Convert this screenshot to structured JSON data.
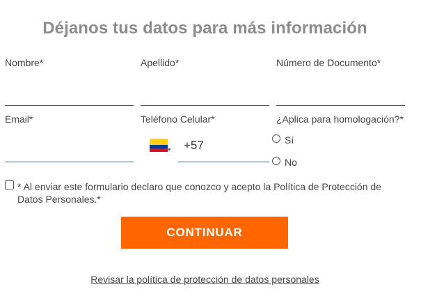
{
  "form": {
    "title": "Déjanos tus datos para más información",
    "fields": {
      "nombre": {
        "label": "Nombre*",
        "value": ""
      },
      "apellido": {
        "label": "Apellido*",
        "value": ""
      },
      "documento": {
        "label": "Número de Documento*",
        "value": ""
      },
      "email": {
        "label": "Email*",
        "value": ""
      },
      "telefono": {
        "label": "Teléfono Celular*",
        "value": "",
        "country_code": "+57",
        "flag_icon": "colombia-flag-icon"
      },
      "homologacion": {
        "label": "¿Aplica para homologación?*",
        "options": [
          "Sí",
          "No"
        ],
        "selected": null
      }
    },
    "consent_text": "* Al enviar este formulario declaro que conozco y acepto la Política de Protección de Datos Personales.*",
    "consent_checked": false,
    "submit_label": "CONTINUAR",
    "policy_link": "Revisar la política de protección de datos personales"
  },
  "colors": {
    "title": "#8c8c8c",
    "button": "#ff6600",
    "underline": "#3f5c70"
  }
}
